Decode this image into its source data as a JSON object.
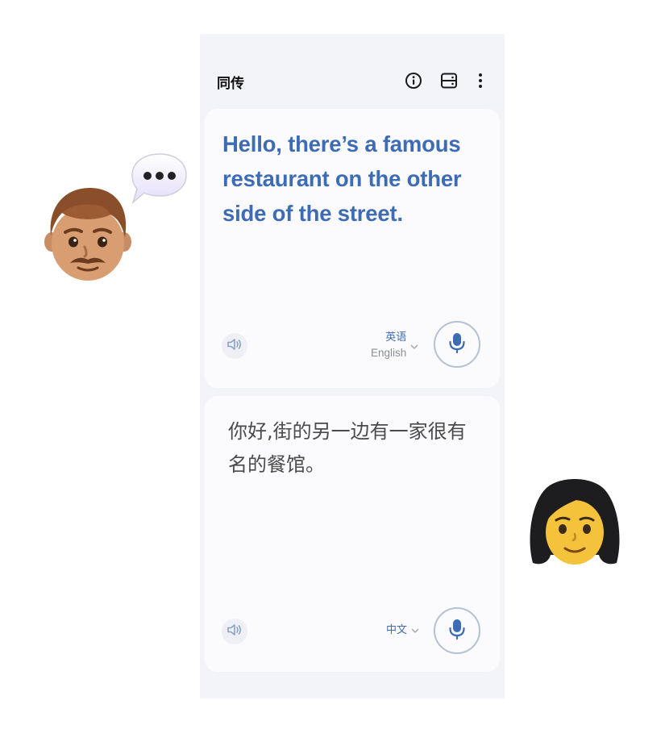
{
  "header": {
    "title": "同传",
    "icons": [
      "info-icon",
      "layout-icon",
      "more-vert-icon"
    ]
  },
  "source_panel": {
    "text": "Hello, there’s a famous restaurant on the other side of the street.",
    "language_primary": "英语",
    "language_secondary": "English",
    "speaker_icon": "speaker-icon",
    "mic_icon": "mic-icon"
  },
  "target_panel": {
    "text": "你好,街的另一边有一家很有名的餐馆。",
    "language_primary": "中文",
    "speaker_icon": "speaker-icon",
    "mic_icon": "mic-icon"
  },
  "colors": {
    "accent": "#3d6cb4",
    "screen_bg": "#f3f4f7",
    "card_bg": "#fbfbfd",
    "mic_ring": "#b5c0d3"
  },
  "decorations": [
    "man-emoji",
    "speech-bubble-emoji",
    "woman-emoji"
  ]
}
